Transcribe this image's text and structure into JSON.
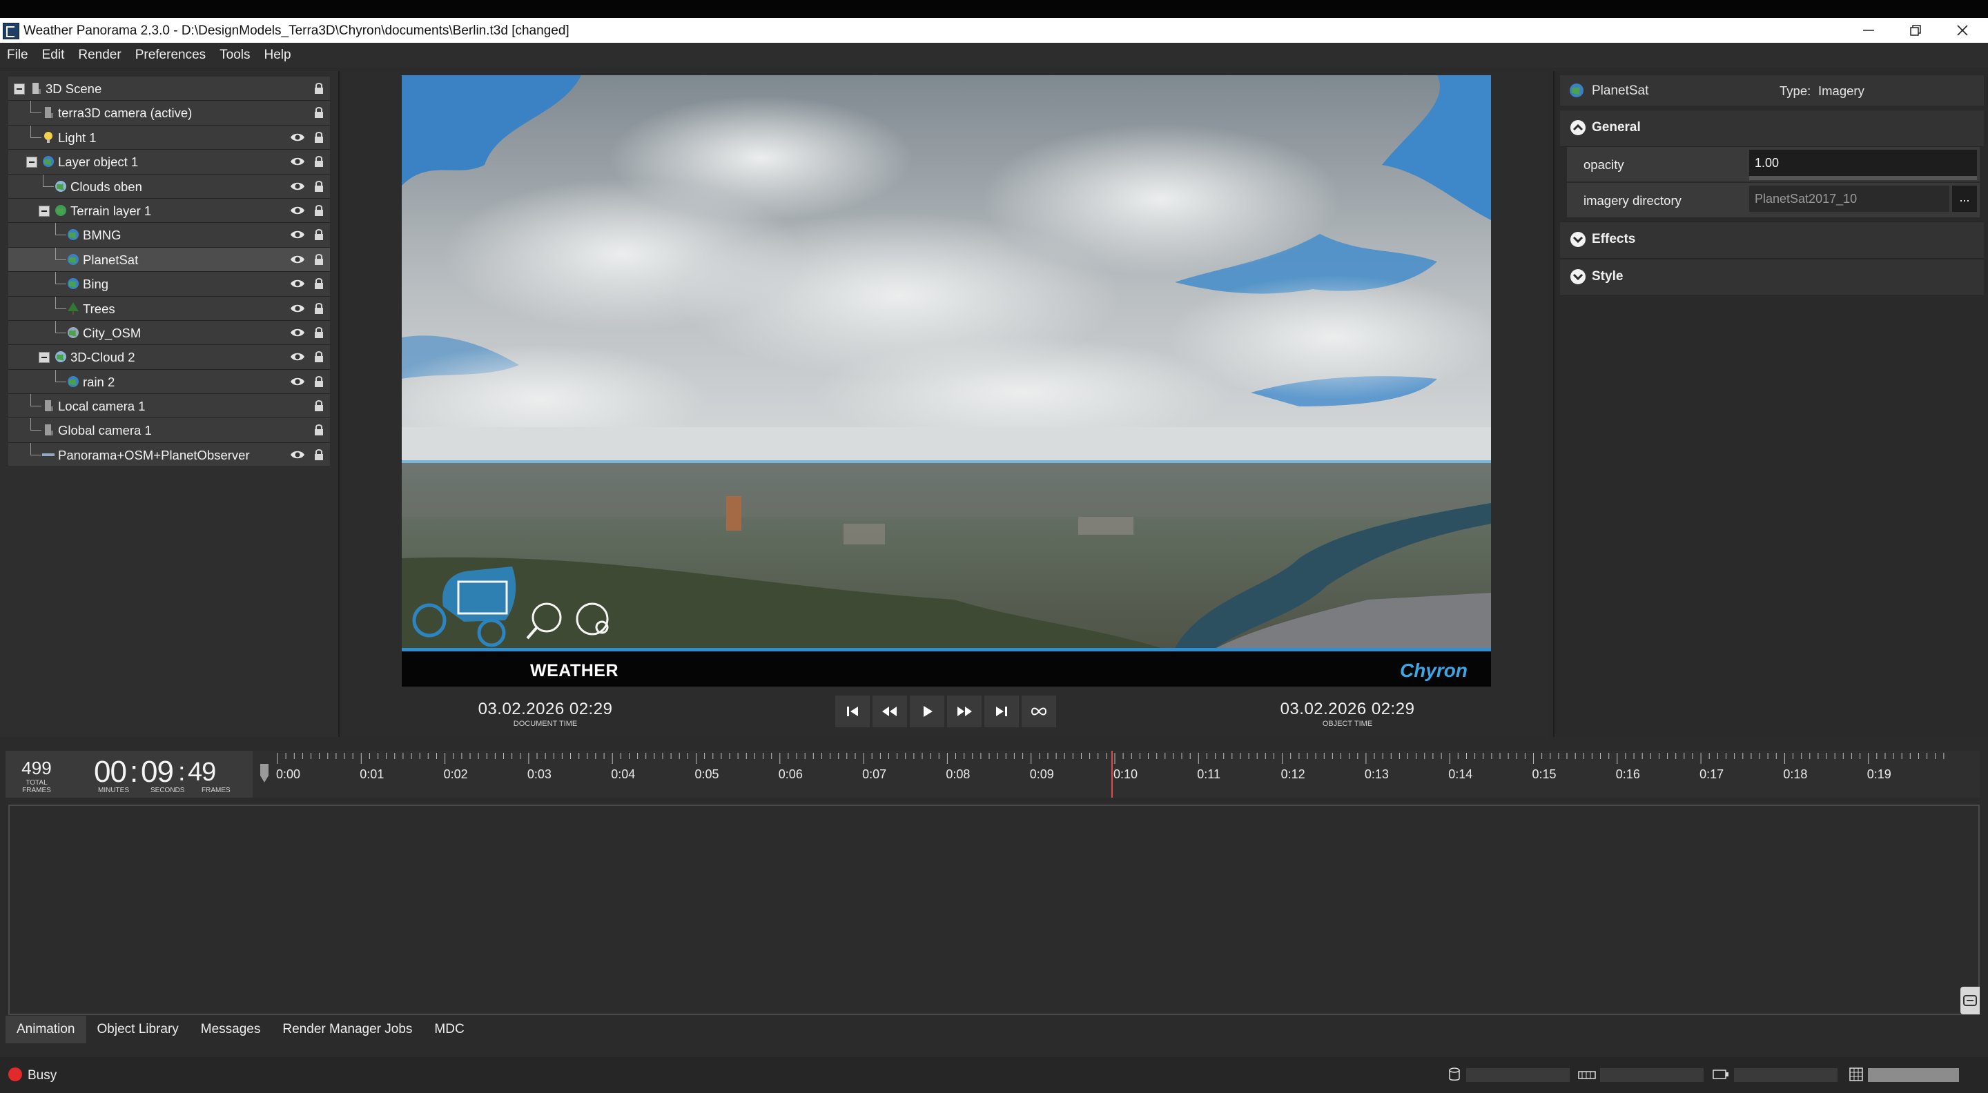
{
  "window": {
    "title": "Weather Panorama 2.3.0 - D:\\DesignModels_Terra3D\\Chyron\\documents\\Berlin.t3d [changed]",
    "controls": [
      "minimize",
      "restore",
      "close"
    ]
  },
  "menu": [
    "File",
    "Edit",
    "Render",
    "Preferences",
    "Tools",
    "Help"
  ],
  "scene_tree": {
    "items": [
      {
        "label": "3D Scene",
        "icon": "scene-icon"
      },
      {
        "label": "terra3D camera (active)",
        "icon": "camera-icon"
      },
      {
        "label": "Light 1",
        "icon": "light-bulb-icon"
      },
      {
        "label": "Layer object 1",
        "icon": "globe-icon"
      },
      {
        "label": "Clouds oben",
        "icon": "cloud-layer-icon"
      },
      {
        "label": "Terrain layer 1",
        "icon": "terrain-icon"
      },
      {
        "label": "BMNG",
        "icon": "globe-icon"
      },
      {
        "label": "PlanetSat",
        "icon": "globe-icon",
        "selected": true
      },
      {
        "label": "Bing",
        "icon": "globe-icon"
      },
      {
        "label": "Trees",
        "icon": "tree-icon"
      },
      {
        "label": "City_OSM",
        "icon": "city-icon"
      },
      {
        "label": "3D-Cloud 2",
        "icon": "cloud-layer-icon"
      },
      {
        "label": "rain 2",
        "icon": "globe-icon"
      },
      {
        "label": "Local camera 1",
        "icon": "camera-icon"
      },
      {
        "label": "Global camera 1",
        "icon": "camera-icon"
      },
      {
        "label": "Panorama+OSM+PlanetObserver",
        "icon": "panorama-icon"
      }
    ]
  },
  "viewport": {
    "overlay_text": "WEATHER",
    "brand": "Chyron"
  },
  "document_time": {
    "value": "03.02.2026  02:29",
    "caption": "DOCUMENT TIME"
  },
  "object_time": {
    "value": "03.02.2026  02:29",
    "caption": "OBJECT TIME"
  },
  "transport": [
    "skip-start-icon",
    "rewind-icon",
    "play-icon",
    "fast-forward-icon",
    "skip-end-icon",
    "loop-icon"
  ],
  "properties": {
    "name": "PlanetSat",
    "type_label": "Type:",
    "type_value": "Imagery",
    "sections": {
      "general": "General",
      "effects": "Effects",
      "style": "Style"
    },
    "opacity": {
      "label": "opacity",
      "value": "1.00"
    },
    "imagery_directory": {
      "label": "imagery directory",
      "value": "PlanetSat2017_10",
      "browse": "..."
    }
  },
  "timecode": {
    "total_frames": "499",
    "total_frames_caption": "TOTAL FRAMES",
    "minutes": "00",
    "seconds": "09",
    "frames": "49",
    "minutes_caption": "MINUTES",
    "seconds_caption": "SECONDS",
    "frames_caption": "FRAMES",
    "separator": ":"
  },
  "ruler": {
    "labels": [
      "0:00",
      "0:01",
      "0:02",
      "0:03",
      "0:04",
      "0:05",
      "0:06",
      "0:07",
      "0:08",
      "0:09",
      "0:10",
      "0:11",
      "0:12",
      "0:13",
      "0:14",
      "0:15",
      "0:16",
      "0:17",
      "0:18",
      "0:19"
    ],
    "playhead_seconds": 9.96
  },
  "tabs": [
    "Animation",
    "Object Library",
    "Messages",
    "Render Manager Jobs",
    "MDC"
  ],
  "status": {
    "text": "Busy"
  },
  "colors": {
    "accent": "#2e8fd0",
    "brand": "#3fa6e6",
    "busy": "#e22a2a",
    "playhead": "#e04a4a"
  }
}
